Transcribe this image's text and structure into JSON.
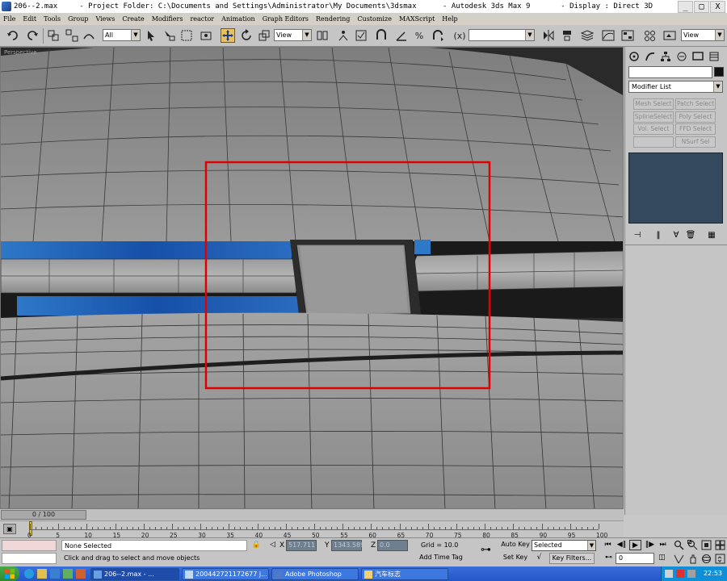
{
  "window": {
    "title": "206--2.max     - Project Folder: C:\\Documents and Settings\\Administrator\\My Documents\\3dsmax      - Autodesk 3ds Max 9       - Display : Direct 3D",
    "controls": [
      "_",
      "□",
      "X"
    ]
  },
  "menu": [
    "File",
    "Edit",
    "Tools",
    "Group",
    "Views",
    "Create",
    "Modifiers",
    "reactor",
    "Animation",
    "Graph Editors",
    "Rendering",
    "Customize",
    "MAXScript",
    "Help"
  ],
  "toolbar": {
    "selection_filter": "All",
    "ref_coord": "View",
    "named_selection": "",
    "render_view": "View"
  },
  "viewport": {
    "label": "Perspective"
  },
  "command_panel": {
    "object_name": "",
    "modifier_list": "Modifier List",
    "modifier_buttons": [
      "Mesh Select",
      "Patch Select",
      "SplineSelect",
      "Poly Select",
      "Vol. Select",
      "FFD Select",
      "",
      "NSurf Sel"
    ]
  },
  "time_slider": {
    "label": "0 / 100"
  },
  "track_bar": {
    "ticks": [
      "0",
      "5",
      "10",
      "15",
      "20",
      "25",
      "30",
      "35",
      "40",
      "45",
      "50",
      "55",
      "60",
      "65",
      "70",
      "75",
      "80",
      "85",
      "90",
      "95",
      "100"
    ]
  },
  "status": {
    "selection": "None Selected",
    "prompt": "Click and drag to select and move objects",
    "x_label": "X",
    "x_value": "517.711",
    "y_label": "Y",
    "y_value": "1343.589",
    "z_label": "Z",
    "z_value": "0.0",
    "grid": "Grid = 10.0",
    "add_time_tag": "Add Time Tag",
    "auto_key": "Auto Key",
    "set_key": "Set Key",
    "key_mode": "Selected",
    "key_filters": "Key Filters...",
    "frame": "0"
  },
  "taskbar": {
    "tasks": [
      "206--2.max     - ...",
      "200442721172677 j...",
      "Adobe Photoshop",
      "汽车标志"
    ],
    "clock": "22:53"
  },
  "colors": {
    "viewport_bg": "#2a2a2a",
    "selection_rect": "#e00000",
    "stack_bg": "#34495e",
    "grille_blue": "#1a5ab0"
  }
}
